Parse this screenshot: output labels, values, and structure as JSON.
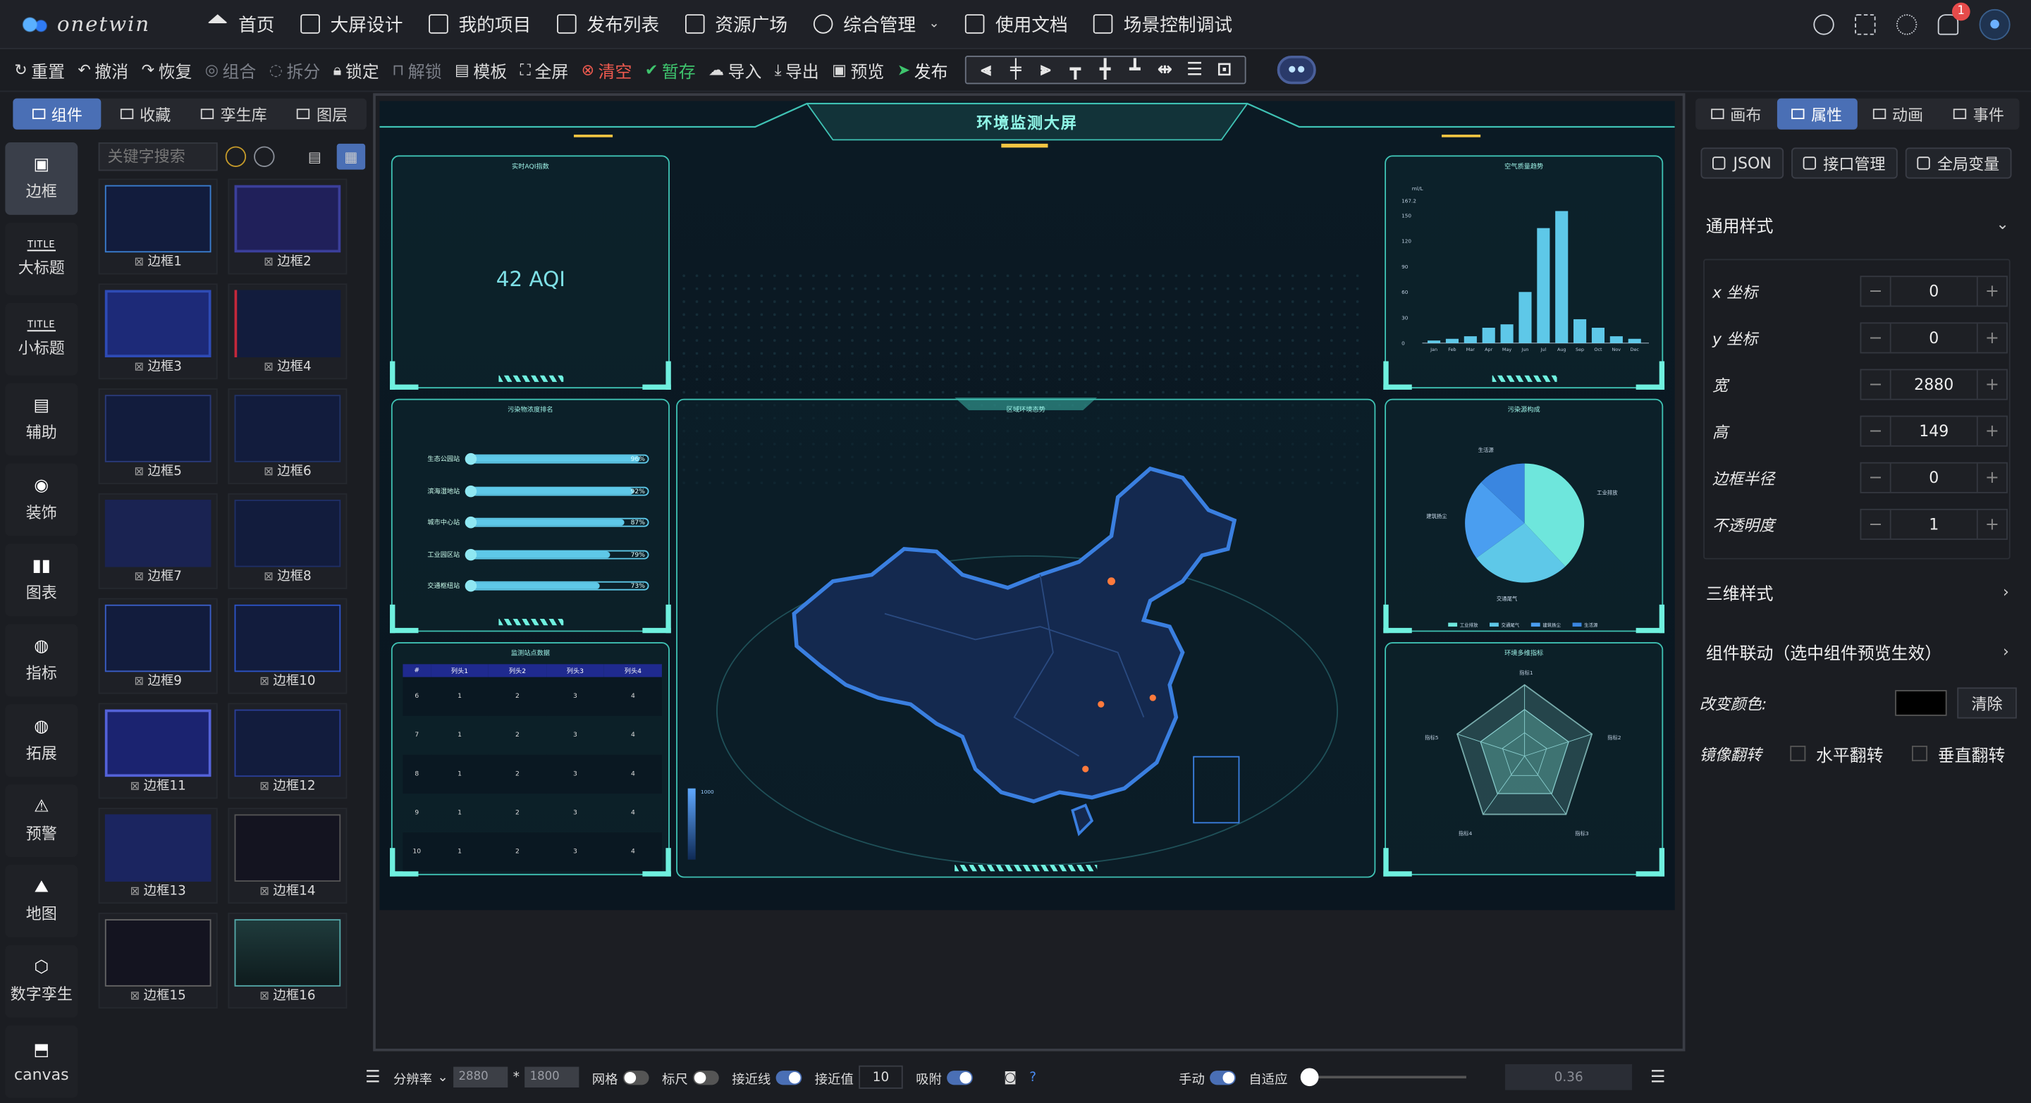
{
  "app": {
    "logo_text": "onetwin"
  },
  "nav": [
    {
      "label": "首页",
      "icon": "home-icon"
    },
    {
      "label": "大屏设计",
      "icon": "screen-icon"
    },
    {
      "label": "我的项目",
      "icon": "folder-icon"
    },
    {
      "label": "发布列表",
      "icon": "list-icon"
    },
    {
      "label": "资源广场",
      "icon": "grid-icon"
    },
    {
      "label": "综合管理",
      "icon": "gear-icon"
    },
    {
      "label": "使用文档",
      "icon": "doc-icon"
    },
    {
      "label": "场景控制调试",
      "icon": "monitor-icon"
    }
  ],
  "notifications": {
    "count": "1"
  },
  "toolbar": {
    "reset": "重置",
    "undo": "撤消",
    "redo": "恢复",
    "group": "组合",
    "ungroup": "拆分",
    "lock": "锁定",
    "unlock": "解锁",
    "template": "模板",
    "fullscreen": "全屏",
    "clear": "清空",
    "save": "暂存",
    "import": "导入",
    "export": "导出",
    "preview": "预览",
    "publish": "发布"
  },
  "left": {
    "tabs": [
      "组件",
      "收藏",
      "孪生库",
      "图层"
    ],
    "categories": [
      "边框",
      "大标题",
      "小标题",
      "辅助",
      "装饰",
      "图表",
      "指标",
      "拓展",
      "预警",
      "地图",
      "数字孪生",
      "canvas"
    ],
    "search_placeholder": "关键字搜索",
    "items": [
      "边框1",
      "边框2",
      "边框3",
      "边框4",
      "边框5",
      "边框6",
      "边框7",
      "边框8",
      "边框9",
      "边框10",
      "边框11",
      "边框12",
      "边框13",
      "边框14",
      "边框15",
      "边框16"
    ]
  },
  "screen": {
    "title": "环境监测大屏",
    "aqi_panel": {
      "title": "实时AQI指数",
      "value": "42 AQI"
    },
    "rank_panel": {
      "title": "污染物浓度排名",
      "rows": [
        {
          "label": "生态公园站",
          "value": 96,
          "text": "96%"
        },
        {
          "label": "滨海湿地站",
          "value": 92,
          "text": "92%"
        },
        {
          "label": "城市中心站",
          "value": 87,
          "text": "87%"
        },
        {
          "label": "工业园区站",
          "value": 79,
          "text": "79%"
        },
        {
          "label": "交通枢纽站",
          "value": 73,
          "text": "73%"
        }
      ]
    },
    "table_panel": {
      "title": "监测站点数据",
      "headers": [
        "#",
        "列头1",
        "列头2",
        "列头3",
        "列头4"
      ],
      "rows": [
        [
          "6",
          "1",
          "2",
          "3",
          "4"
        ],
        [
          "7",
          "1",
          "2",
          "3",
          "4"
        ],
        [
          "8",
          "1",
          "2",
          "3",
          "4"
        ],
        [
          "9",
          "1",
          "2",
          "3",
          "4"
        ],
        [
          "10",
          "1",
          "2",
          "3",
          "4"
        ]
      ]
    },
    "map_panel": {
      "title": "区域环境态势",
      "legend_max": "1000"
    },
    "air_panel": {
      "title": "空气质量趋势",
      "unit": "ml/L"
    },
    "pie_panel": {
      "title": "污染源构成",
      "labels": [
        "工业排放",
        "交通尾气",
        "建筑扬尘",
        "生活源"
      ]
    },
    "radar_panel": {
      "title": "环境多维指标",
      "labels": [
        "指标1",
        "指标2",
        "指标3",
        "指标4",
        "指标5"
      ]
    }
  },
  "chart_data": [
    {
      "type": "bar",
      "title": "空气质量趋势",
      "ylabel": "ml/L",
      "categories": [
        "Jan",
        "Feb",
        "Mar",
        "Apr",
        "May",
        "Jun",
        "Jul",
        "Aug",
        "Sep",
        "Oct",
        "Nov",
        "Dec"
      ],
      "values": [
        3,
        5,
        8,
        18,
        22,
        60,
        135,
        155,
        28,
        18,
        8,
        5
      ],
      "yticks": [
        "0",
        "30",
        "60",
        "90",
        "120",
        "150",
        "167.2"
      ],
      "ylim": [
        0,
        167.2
      ]
    },
    {
      "type": "pie",
      "title": "污染源构成",
      "categories": [
        "工业排放",
        "交通尾气",
        "建筑扬尘",
        "生活源"
      ],
      "values": [
        38,
        27,
        22,
        13
      ]
    }
  ],
  "right": {
    "tabs": [
      "画布",
      "属性",
      "动画",
      "事件"
    ],
    "buttons": [
      "JSON",
      "接口管理",
      "全局变量"
    ],
    "general_style": "通用样式",
    "props": [
      {
        "label": "x 坐标",
        "value": "0"
      },
      {
        "label": "y 坐标",
        "value": "0"
      },
      {
        "label": "宽",
        "value": "2880"
      },
      {
        "label": "高",
        "value": "149"
      },
      {
        "label": "边框半径",
        "value": "0"
      },
      {
        "label": "不透明度",
        "value": "1"
      }
    ],
    "three_d": "三维样式",
    "linkage": "组件联动（选中组件预览生效）",
    "change_color": "改变颜色:",
    "clear": "清除",
    "mirror": "镜像翻转",
    "h_flip": "水平翻转",
    "v_flip": "垂直翻转"
  },
  "bottom": {
    "resolution": "分辨率",
    "width": "2880",
    "height": "1800",
    "grid": "网格",
    "ruler": "标尺",
    "snapline": "接近线",
    "snap_value_label": "接近值",
    "snap_value": "10",
    "adsorb": "吸附",
    "manual": "手动",
    "adaptive": "自适应",
    "zoom": "0.36"
  }
}
